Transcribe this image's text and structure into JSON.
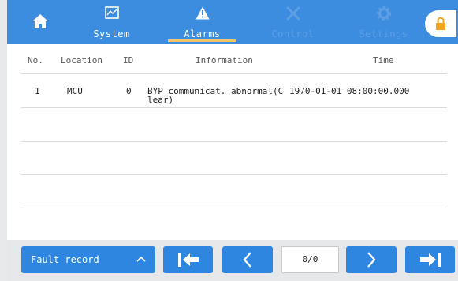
{
  "nav": {
    "home_icon": "home-icon",
    "tabs": [
      {
        "label": "System",
        "icon": "chart-icon",
        "state": "normal"
      },
      {
        "label": "Alarms",
        "icon": "warning-icon",
        "state": "active"
      },
      {
        "label": "Control",
        "icon": "tools-icon",
        "state": "disabled"
      },
      {
        "label": "Settings",
        "icon": "gear-icon",
        "state": "disabled"
      }
    ],
    "lock_icon": "lock-icon"
  },
  "table": {
    "headers": {
      "no": "No.",
      "location": "Location",
      "id": "ID",
      "information": "Information",
      "time": "Time"
    },
    "rows": [
      {
        "no": "1",
        "location": "MCU",
        "id": "0",
        "info_line1": "BYP communicat. abnormal(C",
        "info_line2": "lear)",
        "time": "1970-01-01 08:00:00.000"
      }
    ]
  },
  "footer": {
    "fault_record_label": "Fault record",
    "page_indicator": "0/0"
  },
  "colors": {
    "accent": "#3c8de0",
    "button": "#2f86e1",
    "active_underline": "#f2c46a"
  }
}
